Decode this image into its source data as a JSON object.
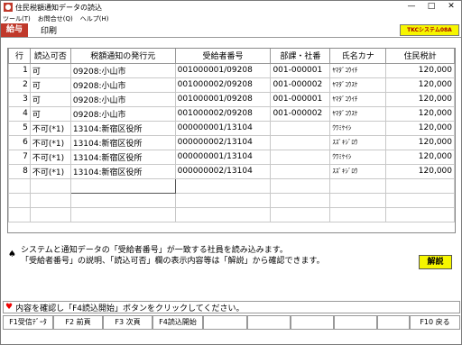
{
  "window": {
    "title": "住民税額通知データの読込",
    "minimize": "—",
    "maximize": "□",
    "close": "✕"
  },
  "menu": {
    "items": [
      "ツール(T)",
      "お問合せ(Q)",
      "ヘルプ(H)"
    ]
  },
  "toolbar": {
    "active_tab": "給与",
    "print_label": "印刷",
    "brand_label": "TKCシステム08A"
  },
  "table": {
    "headers": [
      "行",
      "読込可否",
      "税額通知の発行元",
      "受給者番号",
      "部課・社番",
      "氏名カナ",
      "住民税計"
    ],
    "rows": [
      [
        "1",
        "可",
        "09208:小山市",
        "001000001/09208",
        "001-000001",
        "ﾔﾏﾀﾞｺｳｲﾁ",
        "120,000"
      ],
      [
        "2",
        "可",
        "09208:小山市",
        "001000002/09208",
        "001-000002",
        "ﾔﾏﾀﾞｺｳｽｹ",
        "120,000"
      ],
      [
        "3",
        "可",
        "09208:小山市",
        "001000001/09208",
        "001-000001",
        "ﾔﾏﾀﾞｺｳｲﾁ",
        "120,000"
      ],
      [
        "4",
        "可",
        "09208:小山市",
        "001000002/09208",
        "001-000002",
        "ﾔﾏﾀﾞｺｳｽｹ",
        "120,000"
      ],
      [
        "5",
        "不可(*1)",
        "13104:新宿区役所",
        "000000001/13104",
        "",
        "ｳﾜﾐｹｲｼ",
        "120,000"
      ],
      [
        "6",
        "不可(*1)",
        "13104:新宿区役所",
        "000000002/13104",
        "",
        "ｽｽﾞｷｼﾞﾛｳ",
        "120,000"
      ],
      [
        "7",
        "不可(*1)",
        "13104:新宿区役所",
        "000000001/13104",
        "",
        "ｳﾜﾐｹｲｼ",
        "120,000"
      ],
      [
        "8",
        "不可(*1)",
        "13104:新宿区役所",
        "000000002/13104",
        "",
        "ｽｽﾞｷｼﾞﾛｳ",
        "120,000"
      ]
    ]
  },
  "help": {
    "line1": "システムと通知データの「受給者番号」が一致する社員を読み込みます。",
    "line2": "「受給者番号」の説明、「読込可否」欄の表示内容等は「解説」から確認できます。",
    "button": "解説"
  },
  "status": {
    "message": "内容を確認し「F4読込開始」ボタンをクリックしてください。"
  },
  "fkeys": [
    "F1受信ﾃﾞｰﾀ",
    "F2 前頁",
    "F3 次頁",
    "F4読込開始",
    "",
    "",
    "",
    "",
    "",
    "F10 戻る"
  ]
}
